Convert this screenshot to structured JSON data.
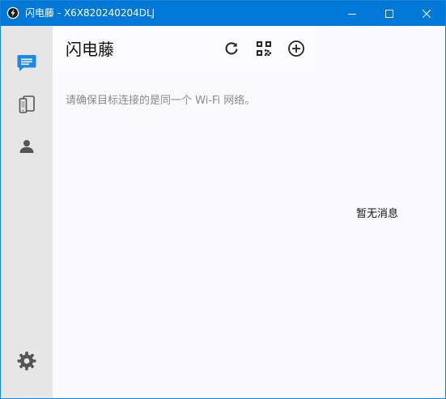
{
  "window": {
    "title": "闪电藤 - X6X820240204DLJ",
    "app_icon": "lightning-vine-app-icon",
    "controls": {
      "minimize_icon": "minimize-icon",
      "maximize_icon": "maximize-icon",
      "close_icon": "close-icon"
    },
    "titlebar_color": "#0078d7"
  },
  "sidebar": {
    "items": [
      {
        "id": "messages",
        "icon": "chat-icon",
        "active": true
      },
      {
        "id": "devices",
        "icon": "devices-icon",
        "active": false
      },
      {
        "id": "contacts",
        "icon": "person-icon",
        "active": false
      }
    ],
    "settings_icon": "gear-icon",
    "accent_color": "#1e88e5"
  },
  "main": {
    "title": "闪电藤",
    "actions": [
      {
        "id": "refresh",
        "icon": "refresh-icon"
      },
      {
        "id": "qr",
        "icon": "qr-code-icon"
      },
      {
        "id": "add",
        "icon": "add-circle-icon"
      }
    ],
    "hint": "请确保目标连接的是同一个 Wi-Fi 网络。",
    "empty_message": "暂无消息"
  }
}
